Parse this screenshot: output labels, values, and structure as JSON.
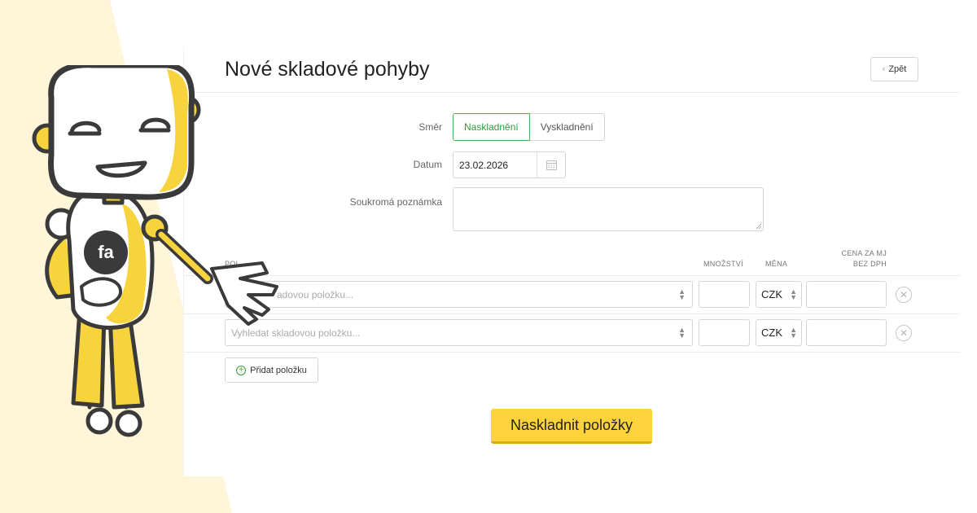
{
  "page": {
    "title": "Nové skladové pohyby",
    "back_label": "Zpět"
  },
  "form": {
    "direction_label": "Směr",
    "direction_options": [
      "Naskladnění",
      "Vyskladnění"
    ],
    "date_label": "Datum",
    "date_value": "23.02.2026",
    "note_label": "Soukromá poznámka",
    "note_value": ""
  },
  "items": {
    "columns": {
      "item": "POL",
      "quantity": "MNOŽSTVÍ",
      "currency": "MĚNA",
      "price_line1": "CENA ZA MJ",
      "price_line2": "BEZ DPH"
    },
    "rows": [
      {
        "placeholder_visible": "adovou položku...",
        "currency": "CZK"
      },
      {
        "placeholder_visible": "Vyhledat skladovou položku...",
        "currency": "CZK"
      }
    ],
    "add_label": "Přidat položku"
  },
  "submit_label": "Naskladnit položky",
  "mascot": {
    "badge_text": "fa"
  },
  "colors": {
    "accent_green": "#2e9b3e",
    "submit_yellow": "#fcd33a",
    "background_cream": "#fff6d9",
    "robot_yellow": "#f7d33e"
  },
  "icons": [
    "chevron-left-icon",
    "calendar-icon",
    "up-down-icon",
    "close-circle-icon",
    "plus-circle-icon"
  ]
}
